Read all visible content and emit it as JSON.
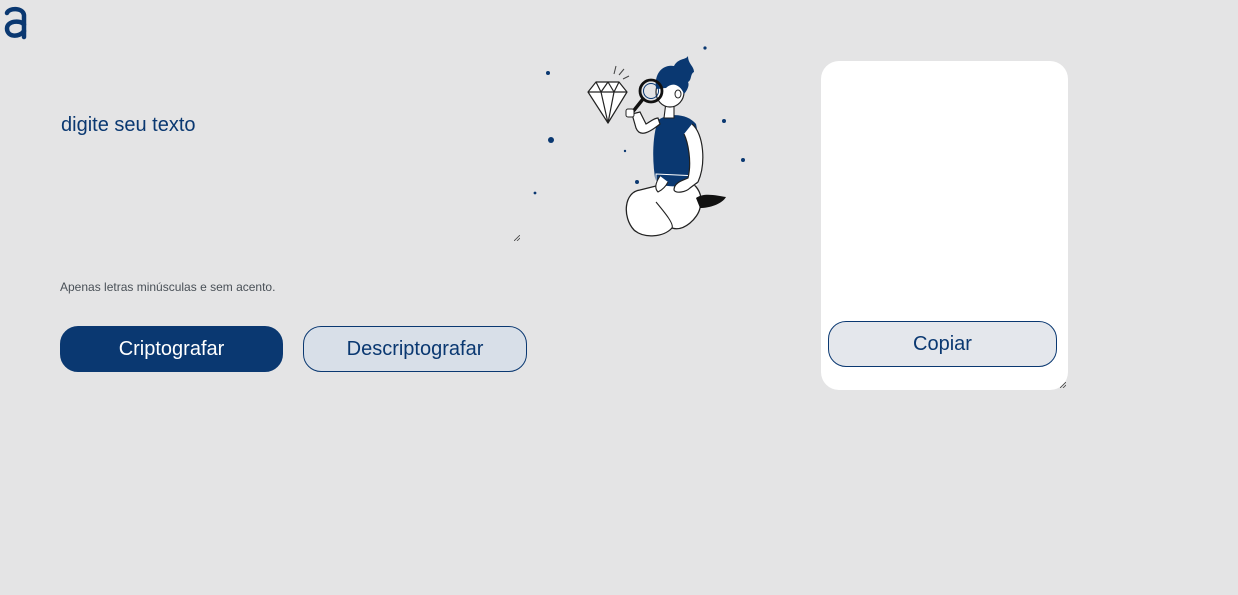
{
  "logo": {
    "icon": "alura-logo-icon",
    "color": "#0a3871"
  },
  "encrypt_form": {
    "input_placeholder": "digite seu texto",
    "input_value": "",
    "hint": "Apenas letras minúsculas e sem acento.",
    "encrypt_label": "Criptografar",
    "decrypt_label": "Descriptografar"
  },
  "output": {
    "value": "",
    "copy_label": "Copiar",
    "illustration_icon": "person-magnifying-glass-diamond-icon"
  },
  "colors": {
    "background": "#e4e4e5",
    "accent": "#0a3871",
    "panel": "#ffffff",
    "secondary_button": "#d8dfe8"
  }
}
